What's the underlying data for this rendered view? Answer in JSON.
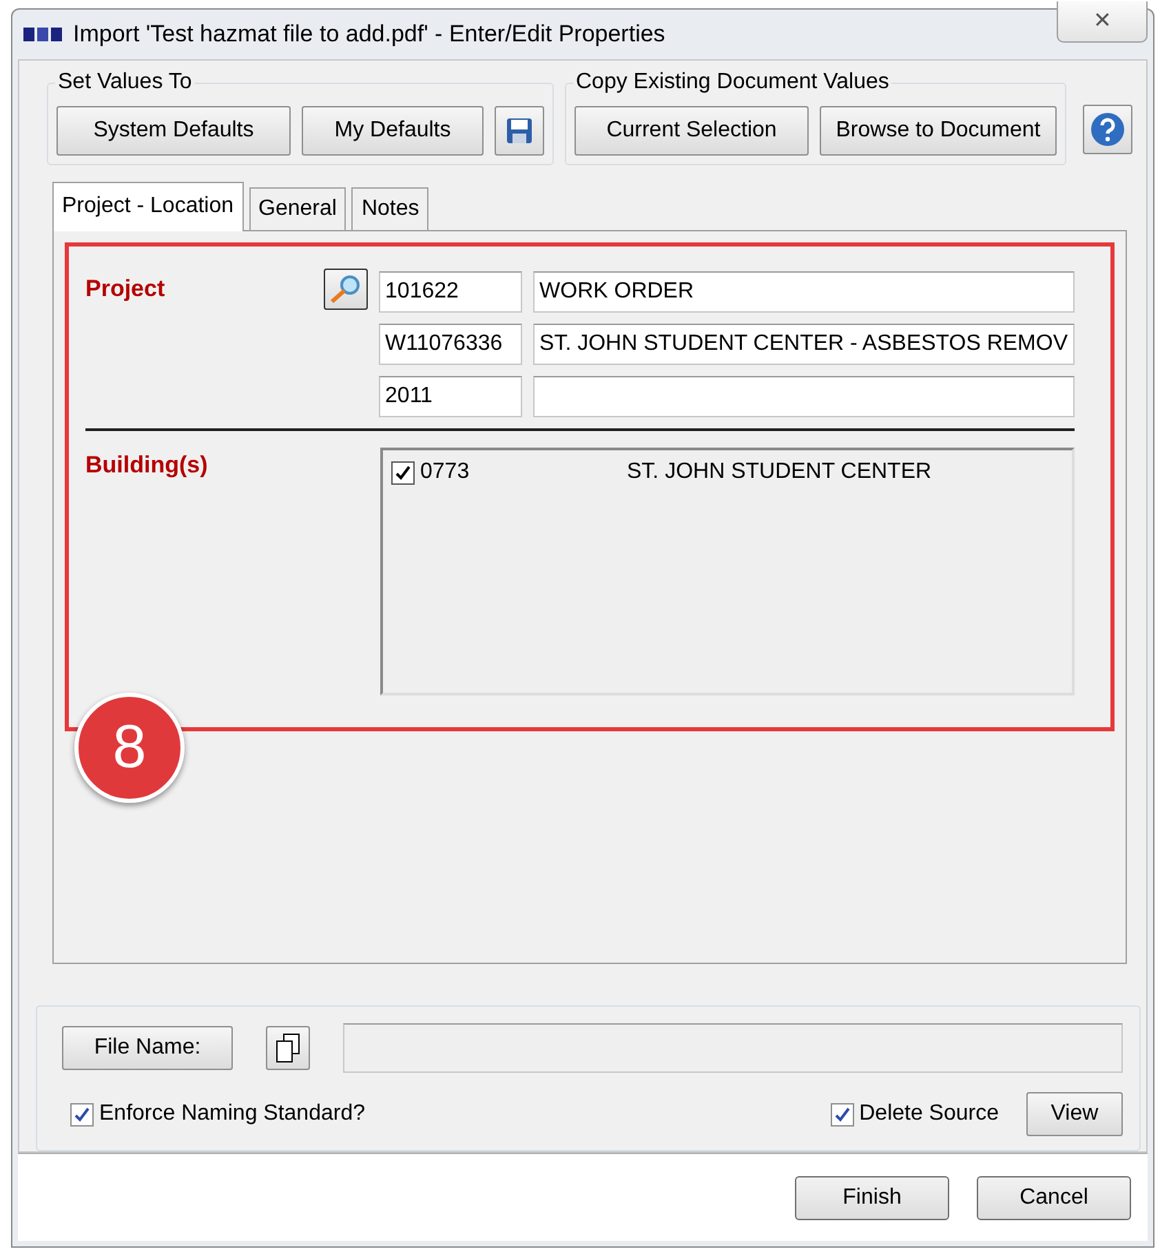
{
  "window": {
    "title": "Import 'Test hazmat file to add.pdf' - Enter/Edit Properties",
    "close": "✕"
  },
  "set_values_to": {
    "label": "Set Values To",
    "buttons": [
      "System Defaults",
      "My Defaults"
    ]
  },
  "copy_existing": {
    "label": "Copy Existing Document Values",
    "buttons": [
      "Current Selection",
      "Browse to Document"
    ]
  },
  "tabs": [
    {
      "label": "Project - Location",
      "selected": true
    },
    {
      "label": "General",
      "selected": false
    },
    {
      "label": "Notes",
      "selected": false
    }
  ],
  "project": {
    "label": "Project",
    "rows": [
      {
        "code": "101622",
        "description": "WORK ORDER"
      },
      {
        "code": "W11076336",
        "description": "ST. JOHN STUDENT CENTER - ASBESTOS REMOV"
      },
      {
        "code": "2011"
      }
    ]
  },
  "buildings": {
    "label": "Building(s)",
    "items": [
      {
        "number": "0773",
        "name": "ST. JOHN STUDENT CENTER",
        "checked": true
      }
    ]
  },
  "annotation": {
    "label": "8"
  },
  "file_name": {
    "button": "File Name:"
  },
  "enforce_naming": {
    "label": "Enforce Naming Standard?",
    "checked": true
  },
  "delete_source": {
    "label": "Delete Source",
    "checked": true
  },
  "view_button": "View",
  "buttons": [
    "Finish",
    "Cancel"
  ]
}
